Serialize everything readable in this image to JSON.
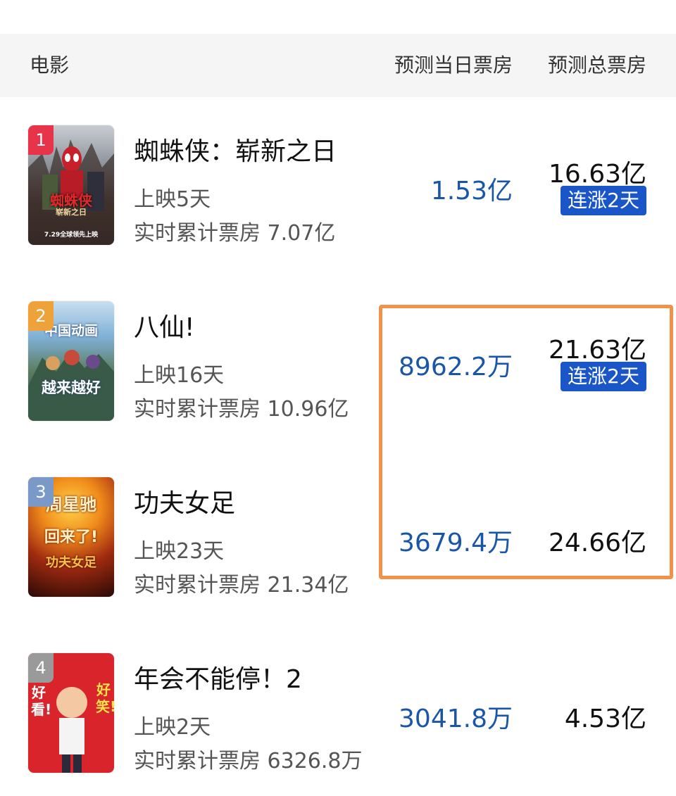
{
  "header": {
    "movie_label": "电影",
    "daily_label": "预测当日票房",
    "total_label": "预测总票房"
  },
  "movies": [
    {
      "rank": "1",
      "title": "蜘蛛侠：崭新之日",
      "days": "上映5天",
      "cumulative": "实时累计票房 7.07亿",
      "daily": "1.53亿",
      "total": "16.63亿",
      "streak": "连涨2天",
      "poster_text": "蜘蛛侠",
      "poster_sub": "崭新之日",
      "poster_date": "7.29全球领先上映",
      "badge_color": "#e8344a"
    },
    {
      "rank": "2",
      "title": "八仙!",
      "days": "上映16天",
      "cumulative": "实时累计票房 10.96亿",
      "daily": "8962.2万",
      "total": "21.63亿",
      "streak": "连涨2天",
      "poster_text": "中国动画",
      "poster_sub": "越来越好",
      "badge_color": "#f0a23a"
    },
    {
      "rank": "3",
      "title": "功夫女足",
      "days": "上映23天",
      "cumulative": "实时累计票房 21.34亿",
      "daily": "3679.4万",
      "total": "24.66亿",
      "poster_text": "周星驰",
      "poster_sub": "回来了!",
      "poster_tag": "功夫女足",
      "badge_color": "#7a98c8"
    },
    {
      "rank": "4",
      "title": "年会不能停！2",
      "days": "上映2天",
      "cumulative": "实时累计票房 6326.8万",
      "daily": "3041.8万",
      "total": "4.53亿",
      "poster_left": "好看!",
      "poster_right": "好笑!",
      "badge_color": "#9a9a9a"
    }
  ]
}
